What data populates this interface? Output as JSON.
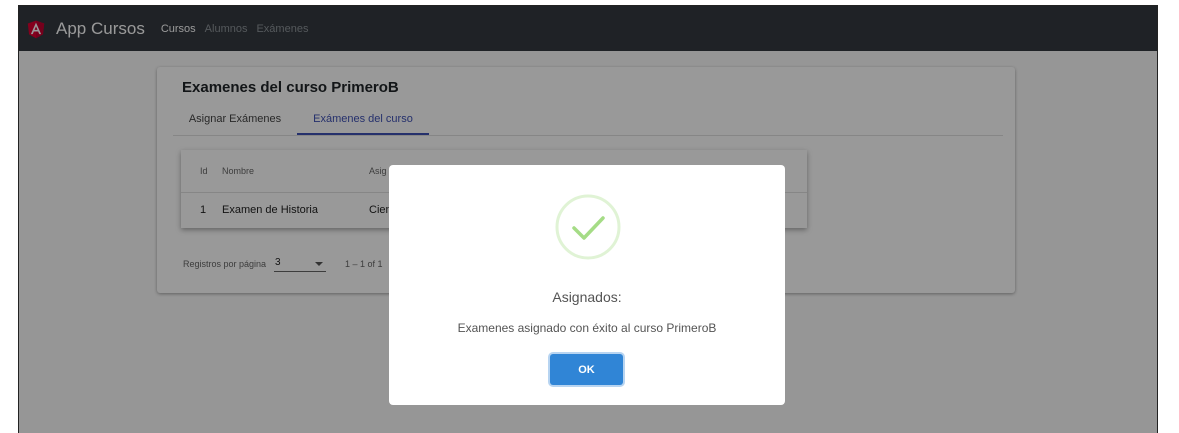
{
  "navbar": {
    "brand": "App Cursos",
    "links": [
      "Cursos",
      "Alumnos",
      "Exámenes"
    ]
  },
  "card": {
    "title": "Examenes del curso PrimeroB",
    "tabs": [
      "Asignar Exámenes",
      "Exámenes del curso"
    ],
    "active_tab": "Exámenes del curso",
    "table": {
      "columns": [
        "Id",
        "Nombre",
        "Asig"
      ],
      "rows": [
        {
          "id": "1",
          "nombre": "Examen de Historia",
          "asignatura": "Cien"
        }
      ]
    },
    "paginator": {
      "label": "Registros por página",
      "page_size": "3",
      "range": "1 – 1 of 1"
    }
  },
  "modal": {
    "icon": "success-check-icon",
    "title": "Asignados:",
    "text": "Examenes asignado con éxito al curso PrimeroB",
    "confirm_label": "OK"
  },
  "colors": {
    "navbar_bg": "#343a40",
    "angular_red": "#dd0031",
    "tab_accent": "#3f51b5",
    "success_green": "#a5dc86",
    "confirm_blue": "#3085d6"
  }
}
